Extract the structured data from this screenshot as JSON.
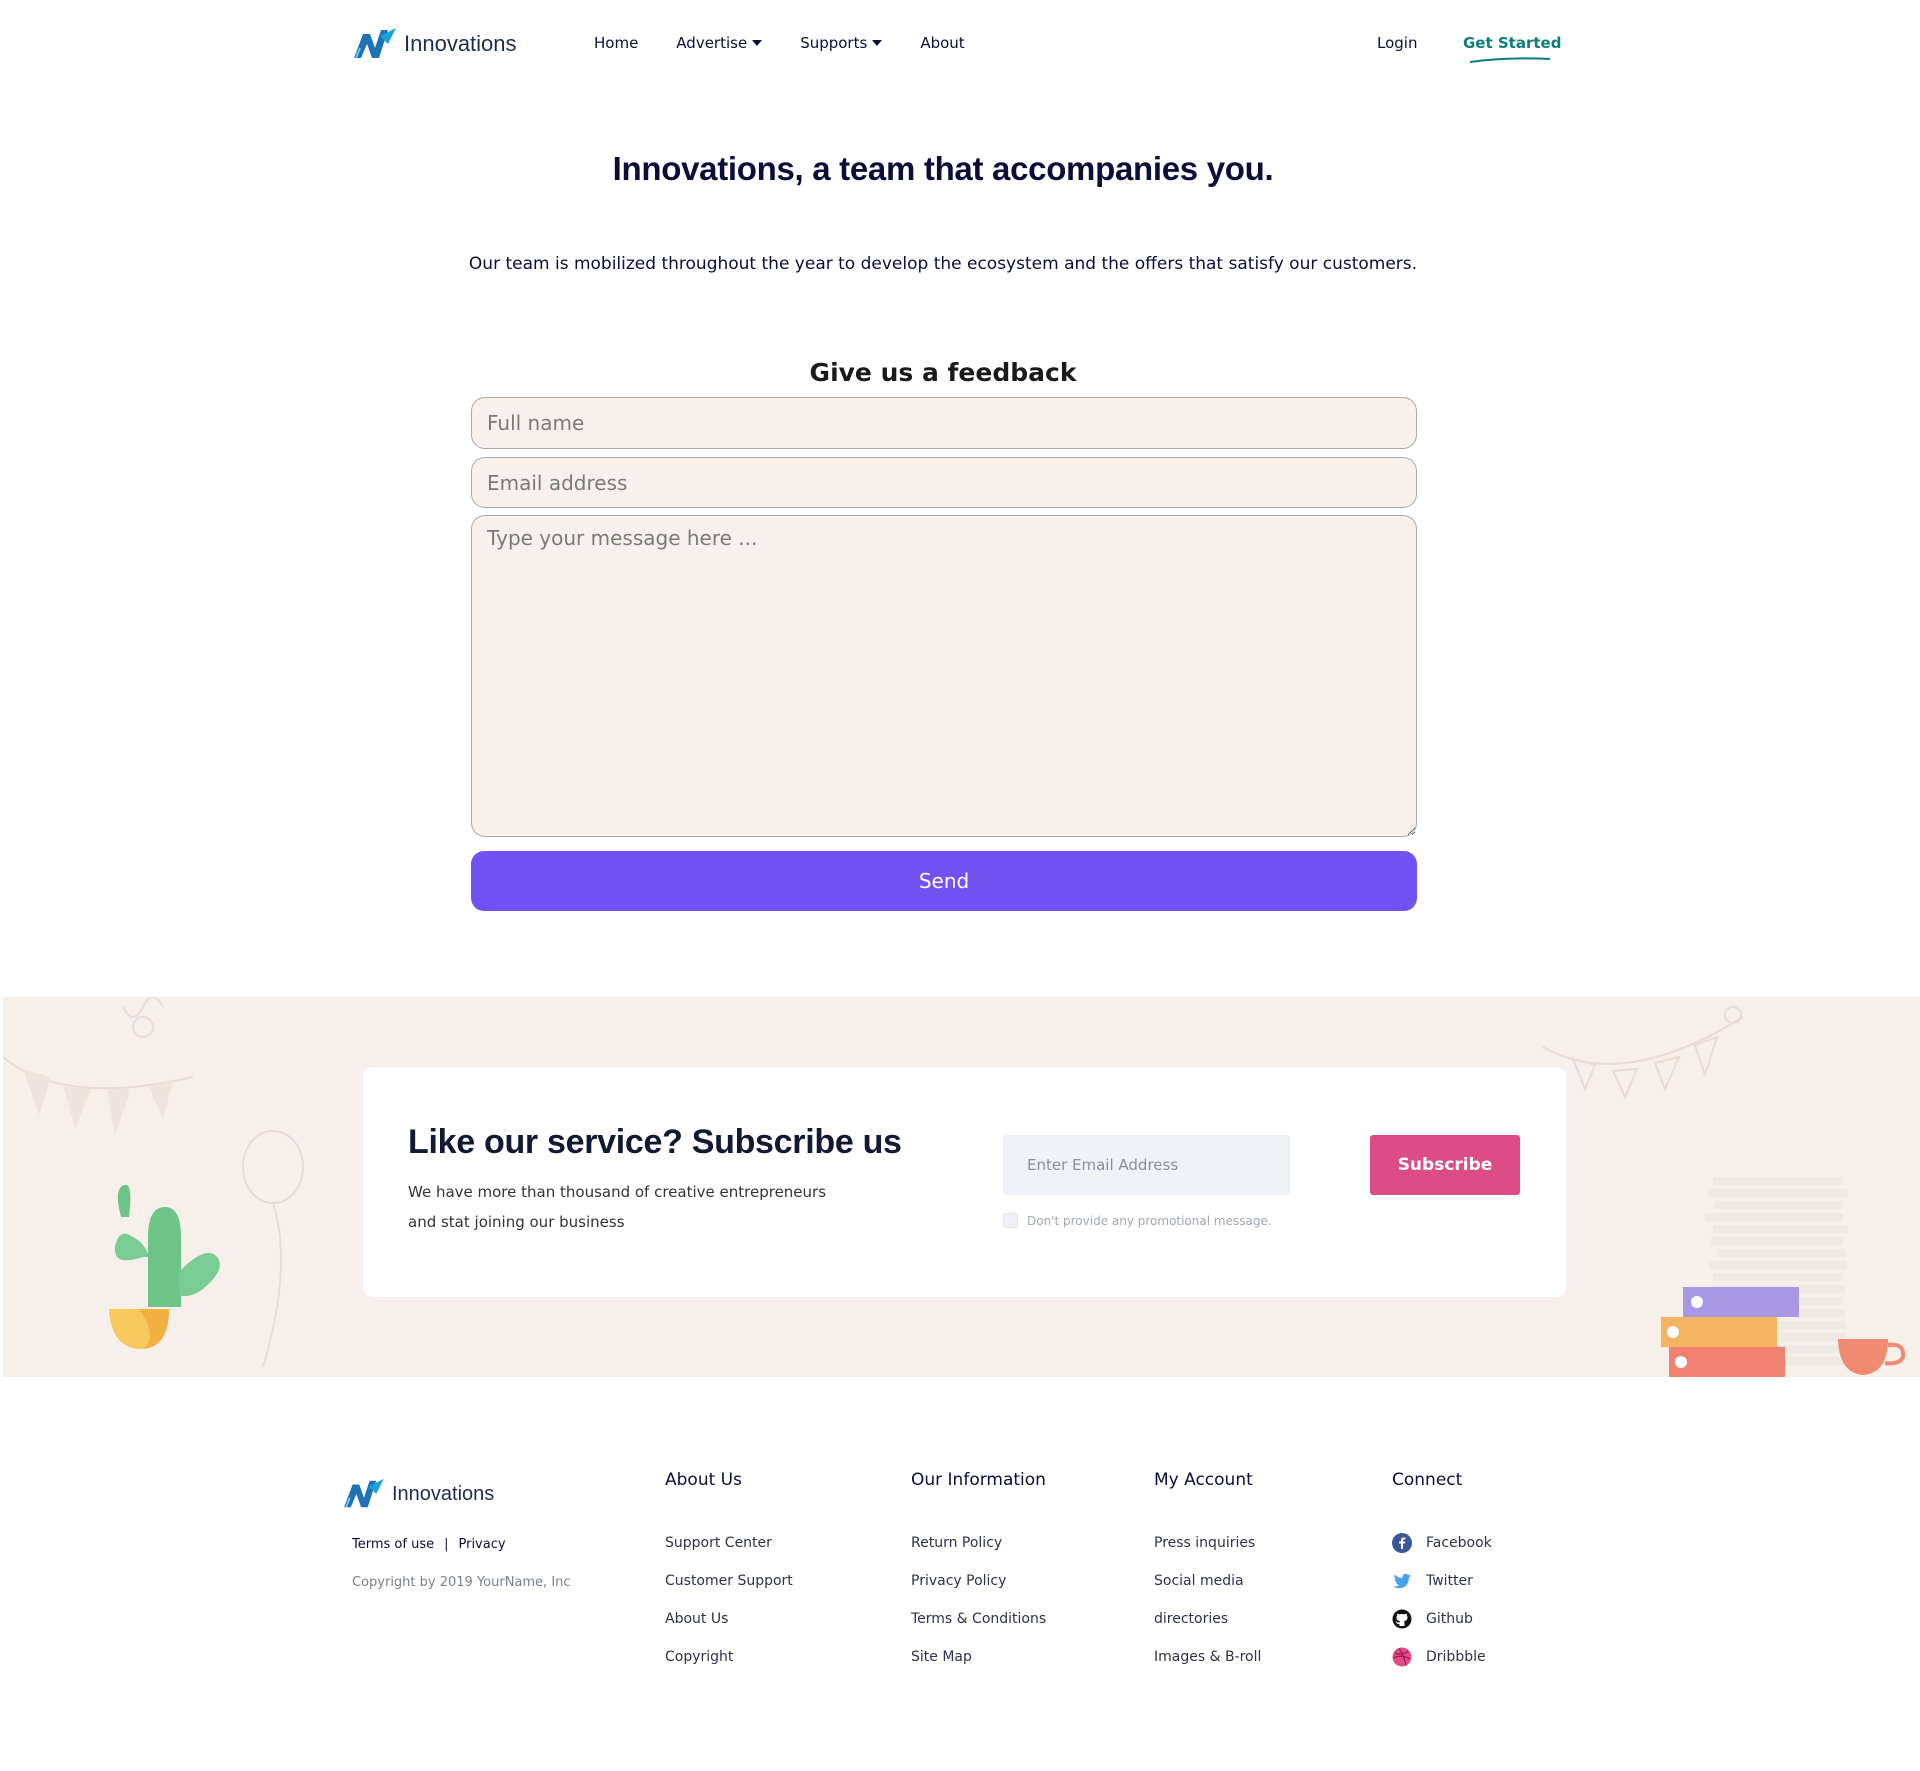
{
  "brand": {
    "name": "Innovations"
  },
  "nav": {
    "items": [
      {
        "label": "Home",
        "dropdown": false
      },
      {
        "label": "Advertise",
        "dropdown": true
      },
      {
        "label": "Supports",
        "dropdown": true
      },
      {
        "label": "About",
        "dropdown": false
      }
    ],
    "login": "Login",
    "get_started": "Get Started"
  },
  "hero": {
    "title": "Innovations, a team that accompanies you.",
    "description": "Our team is mobilized throughout the year to develop the ecosystem and the offers that satisfy our customers."
  },
  "feedback": {
    "title": "Give us a feedback",
    "name_placeholder": "Full name",
    "email_placeholder": "Email address",
    "message_placeholder": "Type your message here ...",
    "send_label": "Send"
  },
  "subscribe": {
    "title": "Like our service? Subscribe us",
    "description": "We have more than thousand of creative entrepreneurs and stat joining our business",
    "email_placeholder": "Enter Email Address",
    "button": "Subscribe",
    "promo_label": "Don't provide any promotional message."
  },
  "footer": {
    "terms": "Terms of use",
    "separator": "|",
    "privacy": "Privacy",
    "copyright": "Copyright by 2019 YourName, Inc",
    "columns": [
      {
        "title": "About Us",
        "links": [
          "Support Center",
          "Customer Support",
          "About Us",
          "Copyright"
        ]
      },
      {
        "title": "Our Information",
        "links": [
          "Return Policy",
          "Privacy Policy",
          "Terms & Conditions",
          "Site Map"
        ]
      },
      {
        "title": "My Account",
        "links": [
          "Press inquiries",
          "Social media",
          "directories",
          "Images & B-roll"
        ]
      },
      {
        "title": "Connect",
        "links": [
          "Facebook",
          "Twitter",
          "Github",
          "Dribbble"
        ],
        "icons": [
          "facebook-icon",
          "twitter-icon",
          "github-icon",
          "dribbble-icon"
        ]
      }
    ]
  },
  "colors": {
    "accent_purple": "#7152f5",
    "subscribe_pink": "#dc4c87",
    "get_started_teal": "#0e7d7a",
    "section_bg": "#f7efea"
  }
}
